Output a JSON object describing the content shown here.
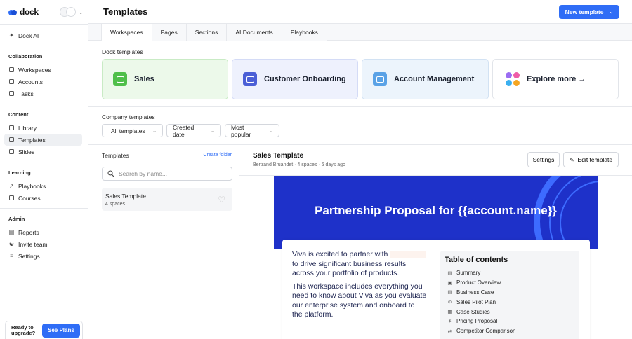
{
  "brand": {
    "name": "dock"
  },
  "sidebar": {
    "top_item": "Dock AI",
    "sections": [
      {
        "title": "Collaboration",
        "items": [
          "Workspaces",
          "Accounts",
          "Tasks"
        ]
      },
      {
        "title": "Content",
        "items": [
          "Library",
          "Templates",
          "Slides"
        ]
      },
      {
        "title": "Learning",
        "items": [
          "Playbooks",
          "Courses"
        ]
      },
      {
        "title": "Admin",
        "items": [
          "Reports",
          "Invite team",
          "Settings"
        ]
      }
    ],
    "active_item": "Templates",
    "upgrade_text": "Ready to upgrade?",
    "upgrade_button": "See Plans"
  },
  "header": {
    "title": "Templates",
    "new_button": "New template"
  },
  "tabs": [
    "Workspaces",
    "Pages",
    "Sections",
    "AI Documents",
    "Playbooks"
  ],
  "dock_templates": {
    "label": "Dock templates",
    "cards": [
      "Sales",
      "Customer Onboarding",
      "Account Management",
      "Explore more →"
    ]
  },
  "company_templates": {
    "label": "Company templates",
    "filters": [
      "All templates",
      "Created date",
      "Most popular"
    ]
  },
  "list": {
    "heading": "Templates",
    "create_folder": "Create folder",
    "search_placeholder": "Search by name...",
    "items": [
      {
        "title": "Sales Template",
        "sub": "4 spaces"
      }
    ]
  },
  "detail": {
    "title": "Sales Template",
    "subtitle": "Bertrand Bruandet · 4 spaces · 6 days ago",
    "settings_button": "Settings",
    "edit_button": "Edit template"
  },
  "preview": {
    "hero_title": "Partnership Proposal for {{account.name}}",
    "para1_a": "Viva is excited to partner with",
    "para1_b": "to drive significant business results across your portfolio of products.",
    "para2": "This workspace includes everything you need to know about Viva as you evaluate our enterprise system and onboard to the platform.",
    "toc_title": "Table of contents",
    "toc_items": [
      "Summary",
      "Product Overview",
      "Business Case",
      "Sales Pilot Plan",
      "Case Studies",
      "Pricing Proposal",
      "Competitor Comparison"
    ]
  },
  "colors": {
    "accent": "#2f6df6",
    "hero": "#1e31c9"
  }
}
